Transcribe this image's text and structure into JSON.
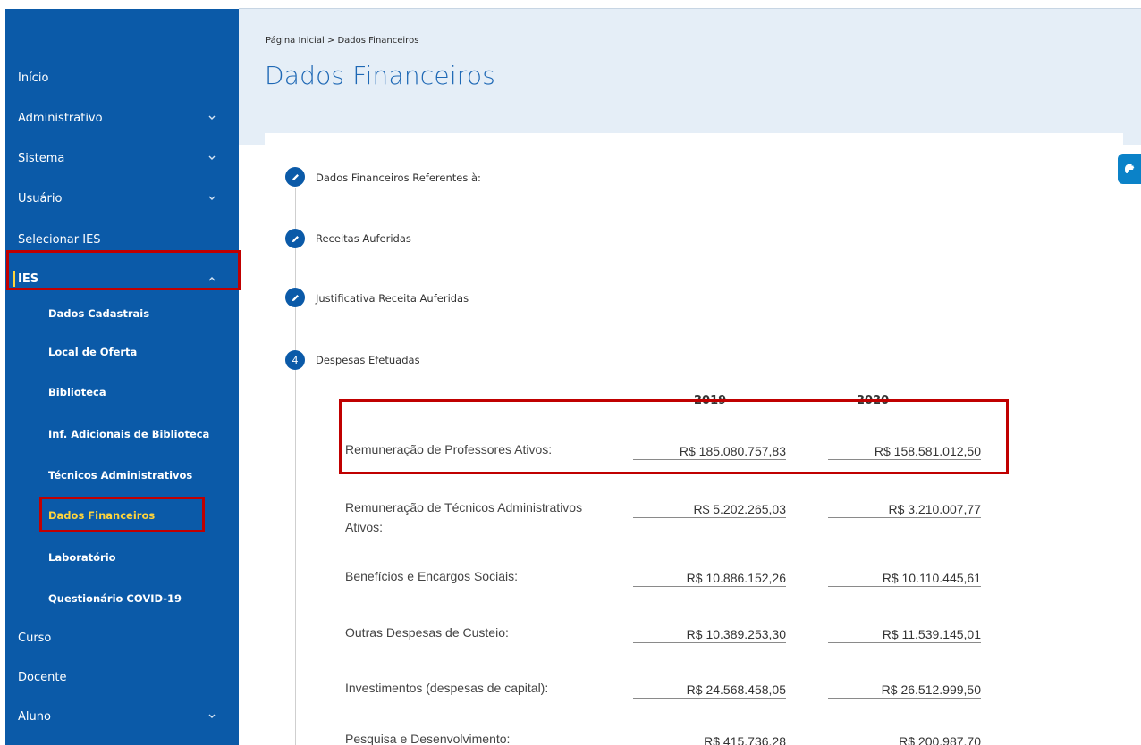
{
  "sidebar": {
    "items": [
      {
        "label": "Início"
      },
      {
        "label": "Administrativo"
      },
      {
        "label": "Sistema"
      },
      {
        "label": "Usuário"
      },
      {
        "label": "Selecionar IES"
      },
      {
        "label": "IES"
      }
    ],
    "ies_subitems": [
      {
        "label": "Dados Cadastrais"
      },
      {
        "label": "Local de Oferta"
      },
      {
        "label": "Biblioteca"
      },
      {
        "label": "Inf. Adicionais de Biblioteca"
      },
      {
        "label": "Técnicos Administrativos"
      },
      {
        "label": "Dados Financeiros"
      },
      {
        "label": "Laboratório"
      },
      {
        "label": "Questionário COVID-19"
      }
    ],
    "bottom_items": [
      {
        "label": "Curso"
      },
      {
        "label": "Docente"
      },
      {
        "label": "Aluno"
      }
    ]
  },
  "header": {
    "breadcrumb": "Página Inicial > Dados Financeiros",
    "title": "Dados Financeiros"
  },
  "steps": [
    {
      "marker": "",
      "icon": "pencil-icon",
      "label": "Dados Financeiros Referentes à:"
    },
    {
      "marker": "",
      "icon": "pencil-icon",
      "label": "Receitas Auferidas"
    },
    {
      "marker": "",
      "icon": "pencil-icon",
      "label": "Justificativa Receita Auferidas"
    },
    {
      "marker": "4",
      "icon": "",
      "label": "Despesas Efetuadas"
    }
  ],
  "expenses": {
    "years": [
      "2019",
      "2020"
    ],
    "rows": [
      {
        "label": "Remuneração de Professores Ativos:",
        "v2019": "R$ 185.080.757,83",
        "v2020": "R$ 158.581.012,50"
      },
      {
        "label": "Remuneração de Técnicos Administrativos Ativos:",
        "v2019": "R$ 5.202.265,03",
        "v2020": "R$ 3.210.007,77"
      },
      {
        "label": "Benefícios e Encargos Sociais:",
        "v2019": "R$ 10.886.152,26",
        "v2020": "R$ 10.110.445,61"
      },
      {
        "label": "Outras Despesas de Custeio:",
        "v2019": "R$ 10.389.253,30",
        "v2020": "R$ 11.539.145,01"
      },
      {
        "label": "Investimentos (despesas de capital):",
        "v2019": "R$ 24.568.458,05",
        "v2020": "R$ 26.512.999,50"
      },
      {
        "label": "Pesquisa e Desenvolvimento:",
        "v2019": "R$ 415.736,28",
        "v2020": "R$ 200.987,70"
      }
    ]
  },
  "colors": {
    "sidebar_bg": "#0b5aa8",
    "active_text": "#ffd43b",
    "highlight_box": "#c00000",
    "title_blue": "#1e68b5",
    "header_bg": "#e5eef7"
  },
  "widgets": {
    "accessibility": {
      "icon": "sign-language-icon"
    }
  }
}
